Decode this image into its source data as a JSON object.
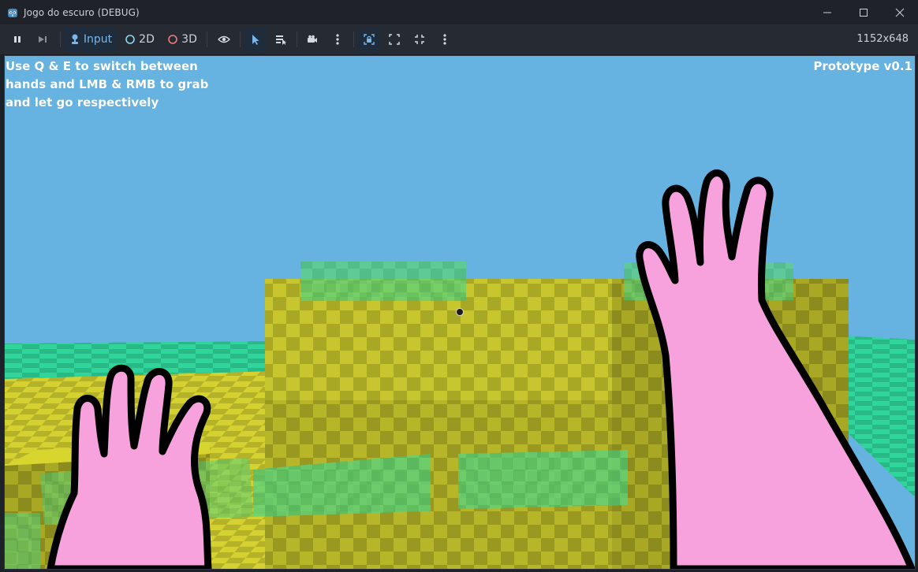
{
  "window": {
    "title": "Jogo do escuro (DEBUG)",
    "app_icon": "godot-icon",
    "controls": [
      "minimize-icon",
      "maximize-icon",
      "close-icon"
    ]
  },
  "toolbar": {
    "pause_icon": "pause-icon",
    "step_icon": "step-frame-icon",
    "input_label": "Input",
    "mode_2d_label": "2D",
    "mode_3d_label": "3D",
    "visibility_icon": "eye-icon",
    "select_icon": "select-arrow-icon",
    "list_icon": "list-select-icon",
    "camera_icon": "camera-icon",
    "resolution": "1152x648",
    "colors": {
      "input_active": "#79b6ea",
      "mode_2d": "#8fd3ef",
      "mode_3d": "#f07a7a"
    }
  },
  "game": {
    "instructions": "Use Q & E to switch between\nhands and LMB & RMB to grab\nand let go respectively",
    "version": "Prototype v0.1",
    "colors": {
      "sky": "#66b3e1",
      "block_yellow": "#c6c42d",
      "ground_teal": "#2fd59a",
      "hand_pink": "#f7a2dc",
      "outline": "#000000"
    }
  }
}
